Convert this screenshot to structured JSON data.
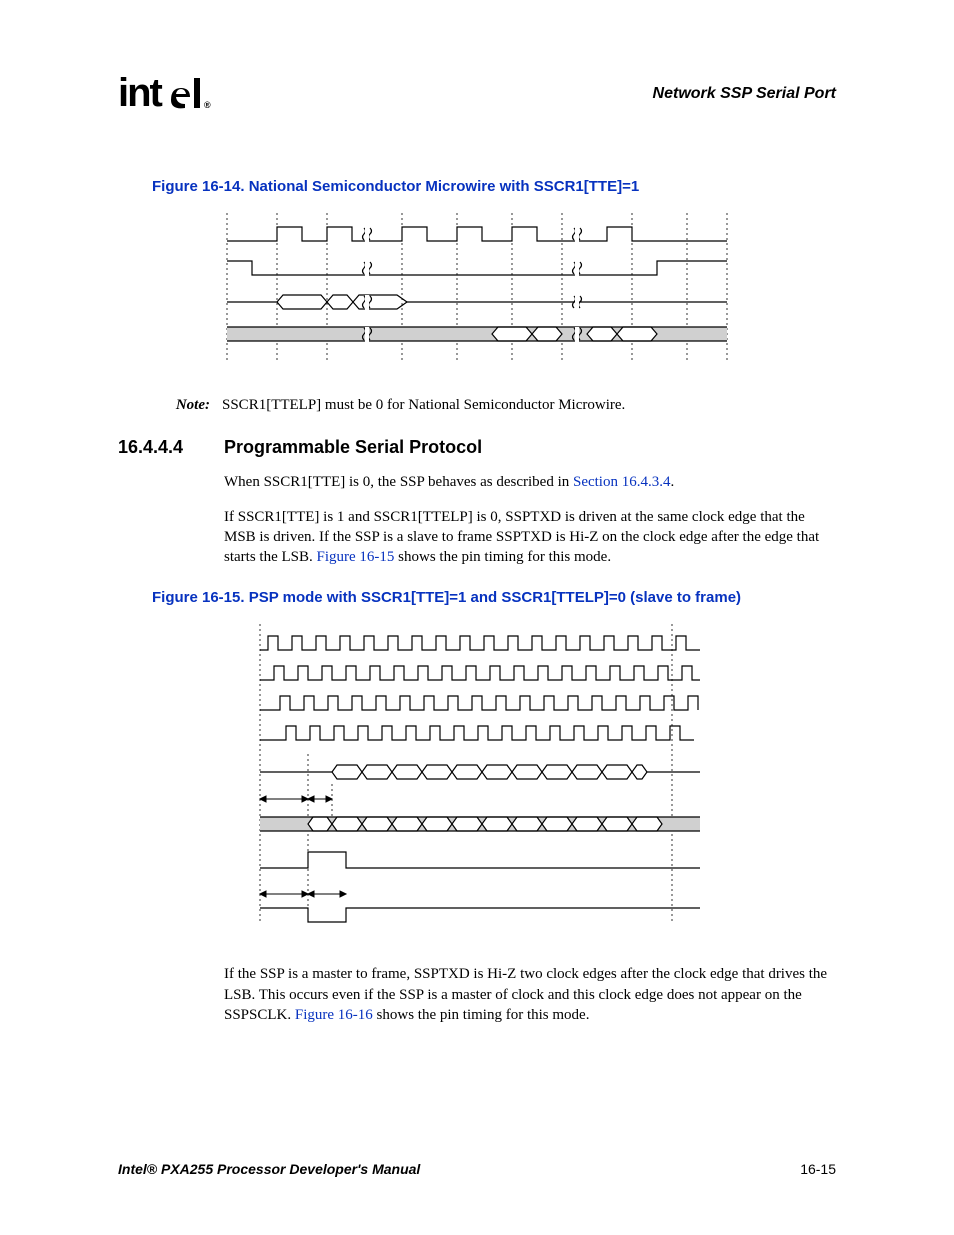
{
  "header": {
    "logo_text": "intel",
    "registered": "®",
    "chapter_title": "Network SSP Serial Port"
  },
  "figure14": {
    "caption": "Figure 16-14. National Semiconductor Microwire with SSCR1[TTE]=1"
  },
  "note": {
    "label": "Note:",
    "text": "SSCR1[TTELP] must be 0 for National Semiconductor Microwire."
  },
  "section": {
    "number": "16.4.4.4",
    "title": "Programmable Serial Protocol"
  },
  "para1": {
    "pre": "When SSCR1[TTE] is 0, the SSP behaves as described in ",
    "link": "Section 16.4.3.4",
    "post": "."
  },
  "para2": {
    "pre": "If SSCR1[TTE] is 1 and SSCR1[TTELP] is 0, SSPTXD is driven at the same clock edge that the MSB is driven. If the SSP is a slave to frame SSPTXD is Hi-Z on the clock edge after the edge that starts the LSB. ",
    "link": "Figure 16-15",
    "post": " shows the pin timing for this mode."
  },
  "figure15": {
    "caption": "Figure 16-15. PSP mode with SSCR1[TTE]=1 and SSCR1[TTELP]=0 (slave to frame)"
  },
  "para3": {
    "pre": "If the SSP is a master to frame, SSPTXD is Hi-Z two clock edges after the clock edge that drives the LSB. This occurs even if the SSP is a master of clock and this clock edge does not appear on the SSPSCLK. ",
    "link": "Figure 16-16",
    "post": " shows the pin timing for this mode."
  },
  "footer": {
    "left": "Intel® PXA255 Processor Developer's Manual",
    "right": "16-15"
  }
}
